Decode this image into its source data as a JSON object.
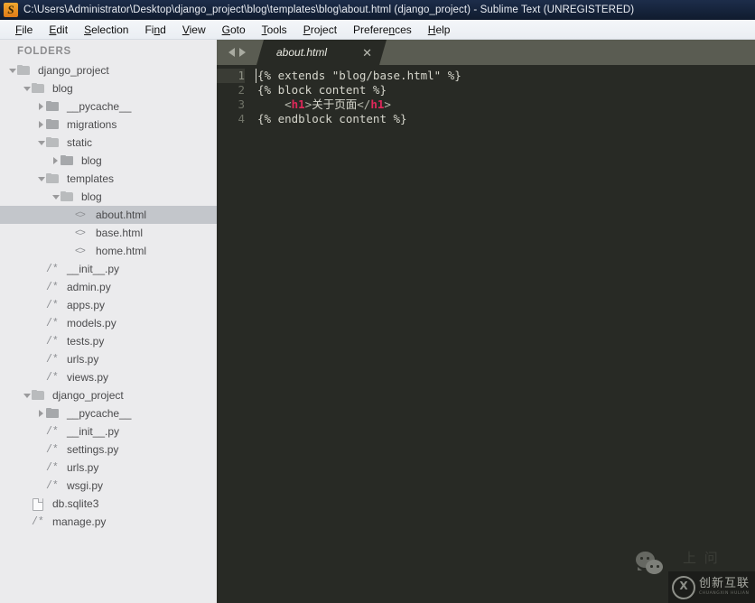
{
  "window": {
    "title": "C:\\Users\\Administrator\\Desktop\\django_project\\blog\\templates\\blog\\about.html (django_project) - Sublime Text (UNREGISTERED)",
    "app_icon": "sublime-text-icon"
  },
  "menubar": {
    "items": [
      {
        "label": "File",
        "mnemonic": "F"
      },
      {
        "label": "Edit",
        "mnemonic": "E"
      },
      {
        "label": "Selection",
        "mnemonic": "S"
      },
      {
        "label": "Find",
        "mnemonic": "n"
      },
      {
        "label": "View",
        "mnemonic": "V"
      },
      {
        "label": "Goto",
        "mnemonic": "G"
      },
      {
        "label": "Tools",
        "mnemonic": "T"
      },
      {
        "label": "Project",
        "mnemonic": "P"
      },
      {
        "label": "Preferences",
        "mnemonic": "n"
      },
      {
        "label": "Help",
        "mnemonic": "H"
      }
    ]
  },
  "sidebar": {
    "header": "FOLDERS",
    "tree": [
      {
        "label": "django_project",
        "indent": 0,
        "icon": "folder-open",
        "twisty": "open",
        "selected": false
      },
      {
        "label": "blog",
        "indent": 1,
        "icon": "folder-open",
        "twisty": "open",
        "selected": false
      },
      {
        "label": "__pycache__",
        "indent": 2,
        "icon": "folder-closed",
        "twisty": "closed",
        "selected": false
      },
      {
        "label": "migrations",
        "indent": 2,
        "icon": "folder-closed",
        "twisty": "closed",
        "selected": false
      },
      {
        "label": "static",
        "indent": 2,
        "icon": "folder-open",
        "twisty": "open",
        "selected": false
      },
      {
        "label": "blog",
        "indent": 3,
        "icon": "folder-closed",
        "twisty": "closed",
        "selected": false
      },
      {
        "label": "templates",
        "indent": 2,
        "icon": "folder-open",
        "twisty": "open",
        "selected": false
      },
      {
        "label": "blog",
        "indent": 3,
        "icon": "folder-open",
        "twisty": "open",
        "selected": false
      },
      {
        "label": "about.html",
        "indent": 4,
        "icon": "code-file",
        "twisty": "none",
        "selected": true
      },
      {
        "label": "base.html",
        "indent": 4,
        "icon": "code-file",
        "twisty": "none",
        "selected": false
      },
      {
        "label": "home.html",
        "indent": 4,
        "icon": "code-file",
        "twisty": "none",
        "selected": false
      },
      {
        "label": "__init__.py",
        "indent": 2,
        "icon": "py-file",
        "twisty": "none",
        "selected": false
      },
      {
        "label": "admin.py",
        "indent": 2,
        "icon": "py-file",
        "twisty": "none",
        "selected": false
      },
      {
        "label": "apps.py",
        "indent": 2,
        "icon": "py-file",
        "twisty": "none",
        "selected": false
      },
      {
        "label": "models.py",
        "indent": 2,
        "icon": "py-file",
        "twisty": "none",
        "selected": false
      },
      {
        "label": "tests.py",
        "indent": 2,
        "icon": "py-file",
        "twisty": "none",
        "selected": false
      },
      {
        "label": "urls.py",
        "indent": 2,
        "icon": "py-file",
        "twisty": "none",
        "selected": false
      },
      {
        "label": "views.py",
        "indent": 2,
        "icon": "py-file",
        "twisty": "none",
        "selected": false
      },
      {
        "label": "django_project",
        "indent": 1,
        "icon": "folder-open",
        "twisty": "open",
        "selected": false
      },
      {
        "label": "__pycache__",
        "indent": 2,
        "icon": "folder-closed",
        "twisty": "closed",
        "selected": false
      },
      {
        "label": "__init__.py",
        "indent": 2,
        "icon": "py-file",
        "twisty": "none",
        "selected": false
      },
      {
        "label": "settings.py",
        "indent": 2,
        "icon": "py-file",
        "twisty": "none",
        "selected": false
      },
      {
        "label": "urls.py",
        "indent": 2,
        "icon": "py-file",
        "twisty": "none",
        "selected": false
      },
      {
        "label": "wsgi.py",
        "indent": 2,
        "icon": "py-file",
        "twisty": "none",
        "selected": false
      },
      {
        "label": "db.sqlite3",
        "indent": 1,
        "icon": "doc-file",
        "twisty": "none",
        "selected": false
      },
      {
        "label": "manage.py",
        "indent": 1,
        "icon": "py-file",
        "twisty": "none",
        "selected": false
      }
    ],
    "icon_glyphs": {
      "code-file": "<>",
      "py-file": "/*"
    }
  },
  "editor": {
    "nav_prev_icon": "arrow-left-icon",
    "nav_next_icon": "arrow-right-icon",
    "tabs": [
      {
        "label": "about.html",
        "close_icon": "close-icon",
        "active": true
      }
    ],
    "line_numbers": [
      "1",
      "2",
      "3",
      "4"
    ],
    "active_line": 1,
    "code_lines": [
      [
        {
          "t": "{% extends \"blog/base.html\" %}",
          "c": "plain"
        }
      ],
      [
        {
          "t": "{% block content %}",
          "c": "plain"
        }
      ],
      [
        {
          "t": "    <",
          "c": "punct"
        },
        {
          "t": "h1",
          "c": "tag"
        },
        {
          "t": ">",
          "c": "punct"
        },
        {
          "t": "关于页面",
          "c": "cjk"
        },
        {
          "t": "</",
          "c": "punct"
        },
        {
          "t": "h1",
          "c": "tag"
        },
        {
          "t": ">",
          "c": "punct"
        }
      ],
      [
        {
          "t": "{% endblock content %}",
          "c": "plain"
        }
      ]
    ]
  },
  "watermark": {
    "wechat_icon": "wechat-icon",
    "ghost_text": "上 问",
    "logo_mark": "circled-x-icon",
    "logo_cn": "创新互联",
    "logo_en": "CHUANGXIN HULIAN"
  },
  "colors": {
    "titlebar": "#16243c",
    "menubar": "#eef1f5",
    "sidebar_bg": "#ebebed",
    "sidebar_selected": "#c3c6cb",
    "editor_bg": "#282a25",
    "tabbar_bg": "#5a5c52",
    "accent_tag": "#e0285a",
    "app_icon": "#e07b18"
  }
}
